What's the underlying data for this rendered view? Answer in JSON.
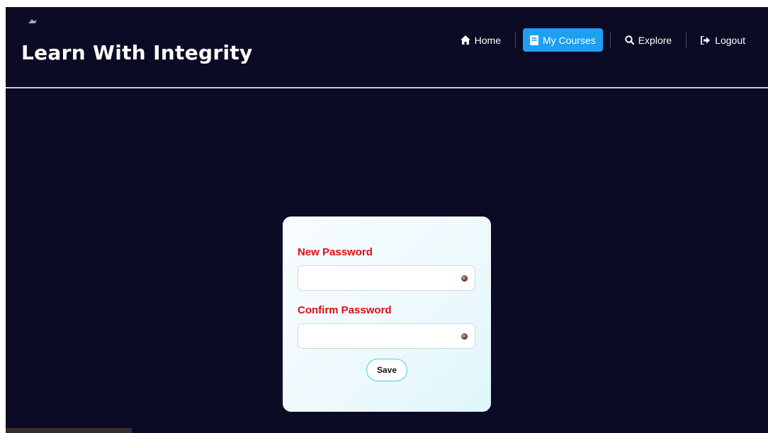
{
  "header": {
    "brand": "Learn With Integrity",
    "logo_icon": "small-bird-logo"
  },
  "nav": {
    "items": [
      {
        "label": "Home",
        "icon": "home-icon",
        "active": false
      },
      {
        "label": "My Courses",
        "icon": "book-icon",
        "active": true
      },
      {
        "label": "Explore",
        "icon": "search-icon",
        "active": false
      },
      {
        "label": "Logout",
        "icon": "logout-icon",
        "active": false
      }
    ]
  },
  "form": {
    "new_password_label": "New Password",
    "new_password_value": "",
    "confirm_password_label": "Confirm Password",
    "confirm_password_value": "",
    "save_label": "Save",
    "toggle_icon": "eye-icon"
  },
  "colors": {
    "background": "#0c0b26",
    "active_tab": "#1e9ff2",
    "label_red": "#dd0d10",
    "save_border": "#47cde0"
  }
}
